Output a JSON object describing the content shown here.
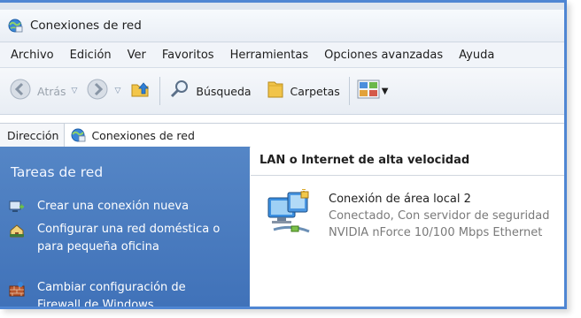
{
  "window": {
    "title": "Conexiones de red"
  },
  "menubar": {
    "items": [
      "Archivo",
      "Edición",
      "Ver",
      "Favoritos",
      "Herramientas",
      "Opciones avanzadas",
      "Ayuda"
    ]
  },
  "toolbar": {
    "back_label": "Atrás",
    "search_label": "Búsqueda",
    "folders_label": "Carpetas"
  },
  "address": {
    "label": "Dirección",
    "value": "Conexiones de red"
  },
  "sidebar": {
    "title": "Tareas de red",
    "tasks": [
      {
        "label": "Crear una conexión nueva",
        "icon": "new-connection-icon"
      },
      {
        "label": "Configurar una red doméstica o para pequeña oficina",
        "icon": "home-network-icon"
      },
      {
        "label": "Cambiar configuración de Firewall de Windows",
        "icon": "firewall-icon"
      }
    ]
  },
  "content": {
    "group_header": "LAN o Internet de alta velocidad",
    "connection": {
      "name": "Conexión de área local 2",
      "status": "Conectado, Con servidor de seguridad",
      "device": "NVIDIA nForce 10/100 Mbps Ethernet"
    }
  },
  "colors": {
    "sidebar_top": "#5586c6",
    "sidebar_bottom": "#3f71b8",
    "frame_border": "#4f86d3"
  }
}
